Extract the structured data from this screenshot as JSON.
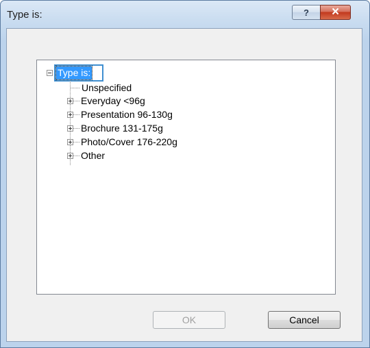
{
  "window": {
    "title": "Type is:",
    "help_glyph": "?",
    "close_glyph": "×"
  },
  "tree": {
    "root_label": "Type is:",
    "items": [
      {
        "label": "Unspecified",
        "expandable": false
      },
      {
        "label": "Everyday <96g",
        "expandable": true
      },
      {
        "label": "Presentation 96-130g",
        "expandable": true
      },
      {
        "label": "Brochure 131-175g",
        "expandable": true
      },
      {
        "label": "Photo/Cover 176-220g",
        "expandable": true
      },
      {
        "label": "Other",
        "expandable": true
      }
    ]
  },
  "buttons": {
    "ok_label": "OK",
    "cancel_label": "Cancel"
  },
  "colors": {
    "selection": "#3399ff",
    "close_button": "#c2391e"
  },
  "icons": [
    "help-icon",
    "close-icon",
    "collapse-icon",
    "expand-icon"
  ]
}
